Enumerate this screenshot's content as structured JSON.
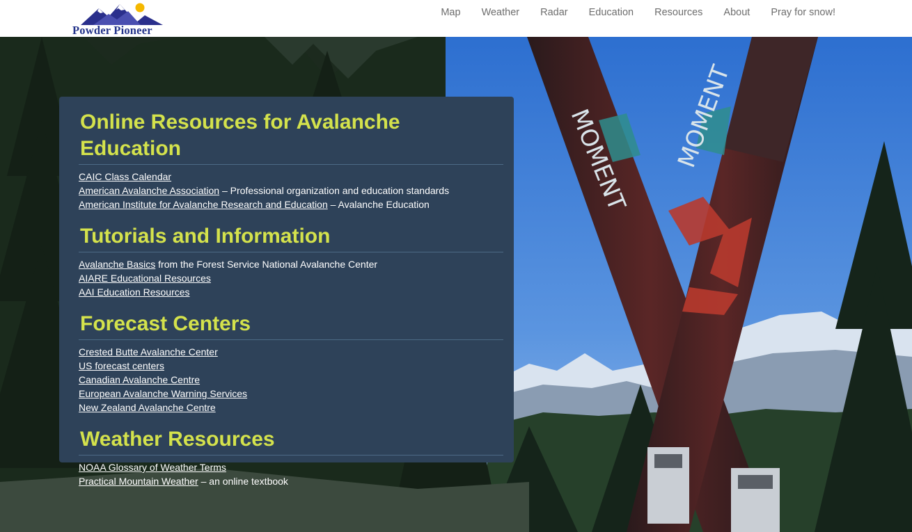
{
  "brand": {
    "name": "Powder Pioneer"
  },
  "nav": {
    "items": [
      {
        "label": "Map"
      },
      {
        "label": "Weather"
      },
      {
        "label": "Radar"
      },
      {
        "label": "Education"
      },
      {
        "label": "Resources"
      },
      {
        "label": "About"
      },
      {
        "label": "Pray for snow!"
      }
    ]
  },
  "hero": {
    "ski_lettering": "MOMENT"
  },
  "colors": {
    "header_bg": "#ffffff",
    "nav_text": "#6d6d6d",
    "panel_bg": "#2e4259",
    "heading": "#d4e24c",
    "link": "#ffffff",
    "logo_blue": "#23338a",
    "logo_sun": "#f5b800"
  },
  "sections": [
    {
      "title": "Online Resources for Avalanche Education",
      "items": [
        {
          "link": "CAIC Class Calendar",
          "text": ""
        },
        {
          "link": "American Avalanche Association",
          "text": " – Professional organization and education standards"
        },
        {
          "link": "American Institute for Avalanche Research and Education",
          "text": " – Avalanche Education"
        }
      ]
    },
    {
      "title": "Tutorials and Information",
      "items": [
        {
          "link": "Avalanche Basics",
          "text": " from the Forest Service National Avalanche Center"
        },
        {
          "link": "AIARE Educational Resources",
          "text": ""
        },
        {
          "link": "AAI Education Resources",
          "text": ""
        }
      ]
    },
    {
      "title": "Forecast Centers",
      "items": [
        {
          "link": "Crested Butte Avalanche Center",
          "text": ""
        },
        {
          "link": "US forecast centers",
          "text": ""
        },
        {
          "link": "Canadian Avalanche Centre",
          "text": ""
        },
        {
          "link": "European Avalanche Warning Services",
          "text": ""
        },
        {
          "link": "New Zealand Avalanche Centre",
          "text": ""
        }
      ]
    },
    {
      "title": "Weather Resources",
      "items": [
        {
          "link": "NOAA Glossary of Weather Terms",
          "text": ""
        },
        {
          "link": "Practical Mountain Weather",
          "text": " – an online textbook"
        }
      ]
    }
  ]
}
